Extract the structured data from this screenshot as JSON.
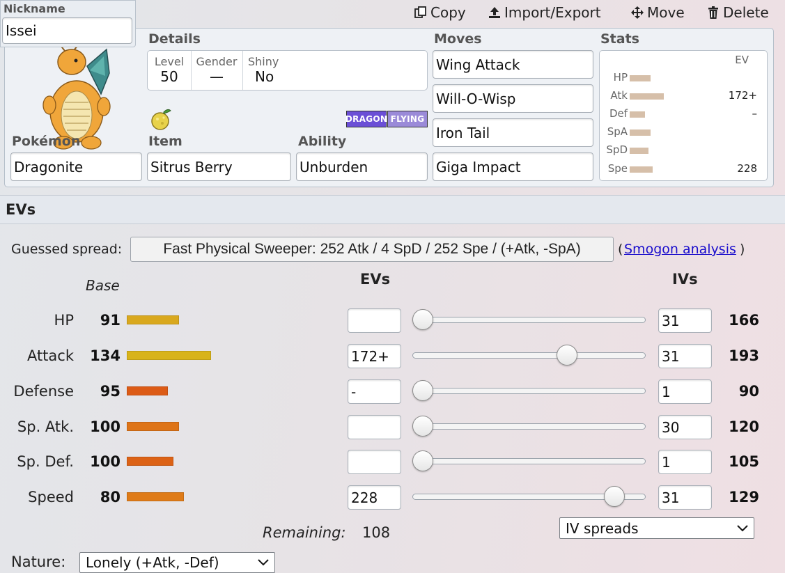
{
  "toolbar": {
    "copy": "Copy",
    "import_export": "Import/Export",
    "move": "Move",
    "delete": "Delete"
  },
  "nickname": {
    "label": "Nickname",
    "value": "Issei"
  },
  "details": {
    "label": "Details",
    "level_label": "Level",
    "level": "50",
    "gender_label": "Gender",
    "gender": "—",
    "shiny_label": "Shiny",
    "shiny": "No"
  },
  "types": [
    "DRAGON",
    "FLYING"
  ],
  "pokemon": {
    "label": "Pokémon",
    "value": "Dragonite"
  },
  "item": {
    "label": "Item",
    "value": "Sitrus Berry"
  },
  "ability": {
    "label": "Ability",
    "value": "Unburden"
  },
  "moves": {
    "label": "Moves",
    "list": [
      "Wing Attack",
      "Will-O-Wisp",
      "Iron Tail",
      "Giga Impact"
    ]
  },
  "stats_panel": {
    "label": "Stats",
    "ev_header": "EV",
    "rows": [
      {
        "label": "HP",
        "ev": ""
      },
      {
        "label": "Atk",
        "ev": "172+"
      },
      {
        "label": "Def",
        "ev": "–"
      },
      {
        "label": "SpA",
        "ev": ""
      },
      {
        "label": "SpD",
        "ev": ""
      },
      {
        "label": "Spe",
        "ev": "228"
      }
    ]
  },
  "evs_section": {
    "title": "EVs",
    "guessed_label": "Guessed spread:",
    "guessed_value": "Fast Physical Sweeper: 252 Atk / 4 SpD / 252 Spe / (+Atk, -SpA)",
    "paren_open": "(",
    "smogon_link": "Smogon analysis",
    "paren_close": ")",
    "base_header": "Base",
    "evs_header": "EVs",
    "ivs_header": "IVs",
    "rows": [
      {
        "name": "HP",
        "base": "91",
        "ev": "",
        "iv": "31",
        "total": "166",
        "slider_fraction": 0.0
      },
      {
        "name": "Attack",
        "base": "134",
        "ev": "172+",
        "iv": "31",
        "total": "193",
        "slider_fraction": 0.68
      },
      {
        "name": "Defense",
        "base": "95",
        "ev": "-",
        "iv": "1",
        "total": "90",
        "slider_fraction": 0.0
      },
      {
        "name": "Sp. Atk.",
        "base": "100",
        "ev": "",
        "iv": "30",
        "total": "120",
        "slider_fraction": 0.0
      },
      {
        "name": "Sp. Def.",
        "base": "100",
        "ev": "",
        "iv": "1",
        "total": "105",
        "slider_fraction": 0.0
      },
      {
        "name": "Speed",
        "base": "80",
        "ev": "228",
        "iv": "31",
        "total": "129",
        "slider_fraction": 0.9
      }
    ],
    "remaining_label": "Remaining:",
    "remaining_value": "108",
    "iv_spreads": "IV spreads",
    "nature_label": "Nature:",
    "nature_value": "Lonely (+Atk, -Def)"
  },
  "colors": {
    "bar_hp": "#d9a81e",
    "bar_atk": "#d8b31a",
    "bar_def": "#dc5b16",
    "bar_spa": "#de7418",
    "bar_spd": "#dc6216",
    "bar_spe": "#df7b18",
    "type_dragon": "#6b4fd6",
    "type_flying": "#9a8ad8",
    "link": "#1a0dcc"
  }
}
